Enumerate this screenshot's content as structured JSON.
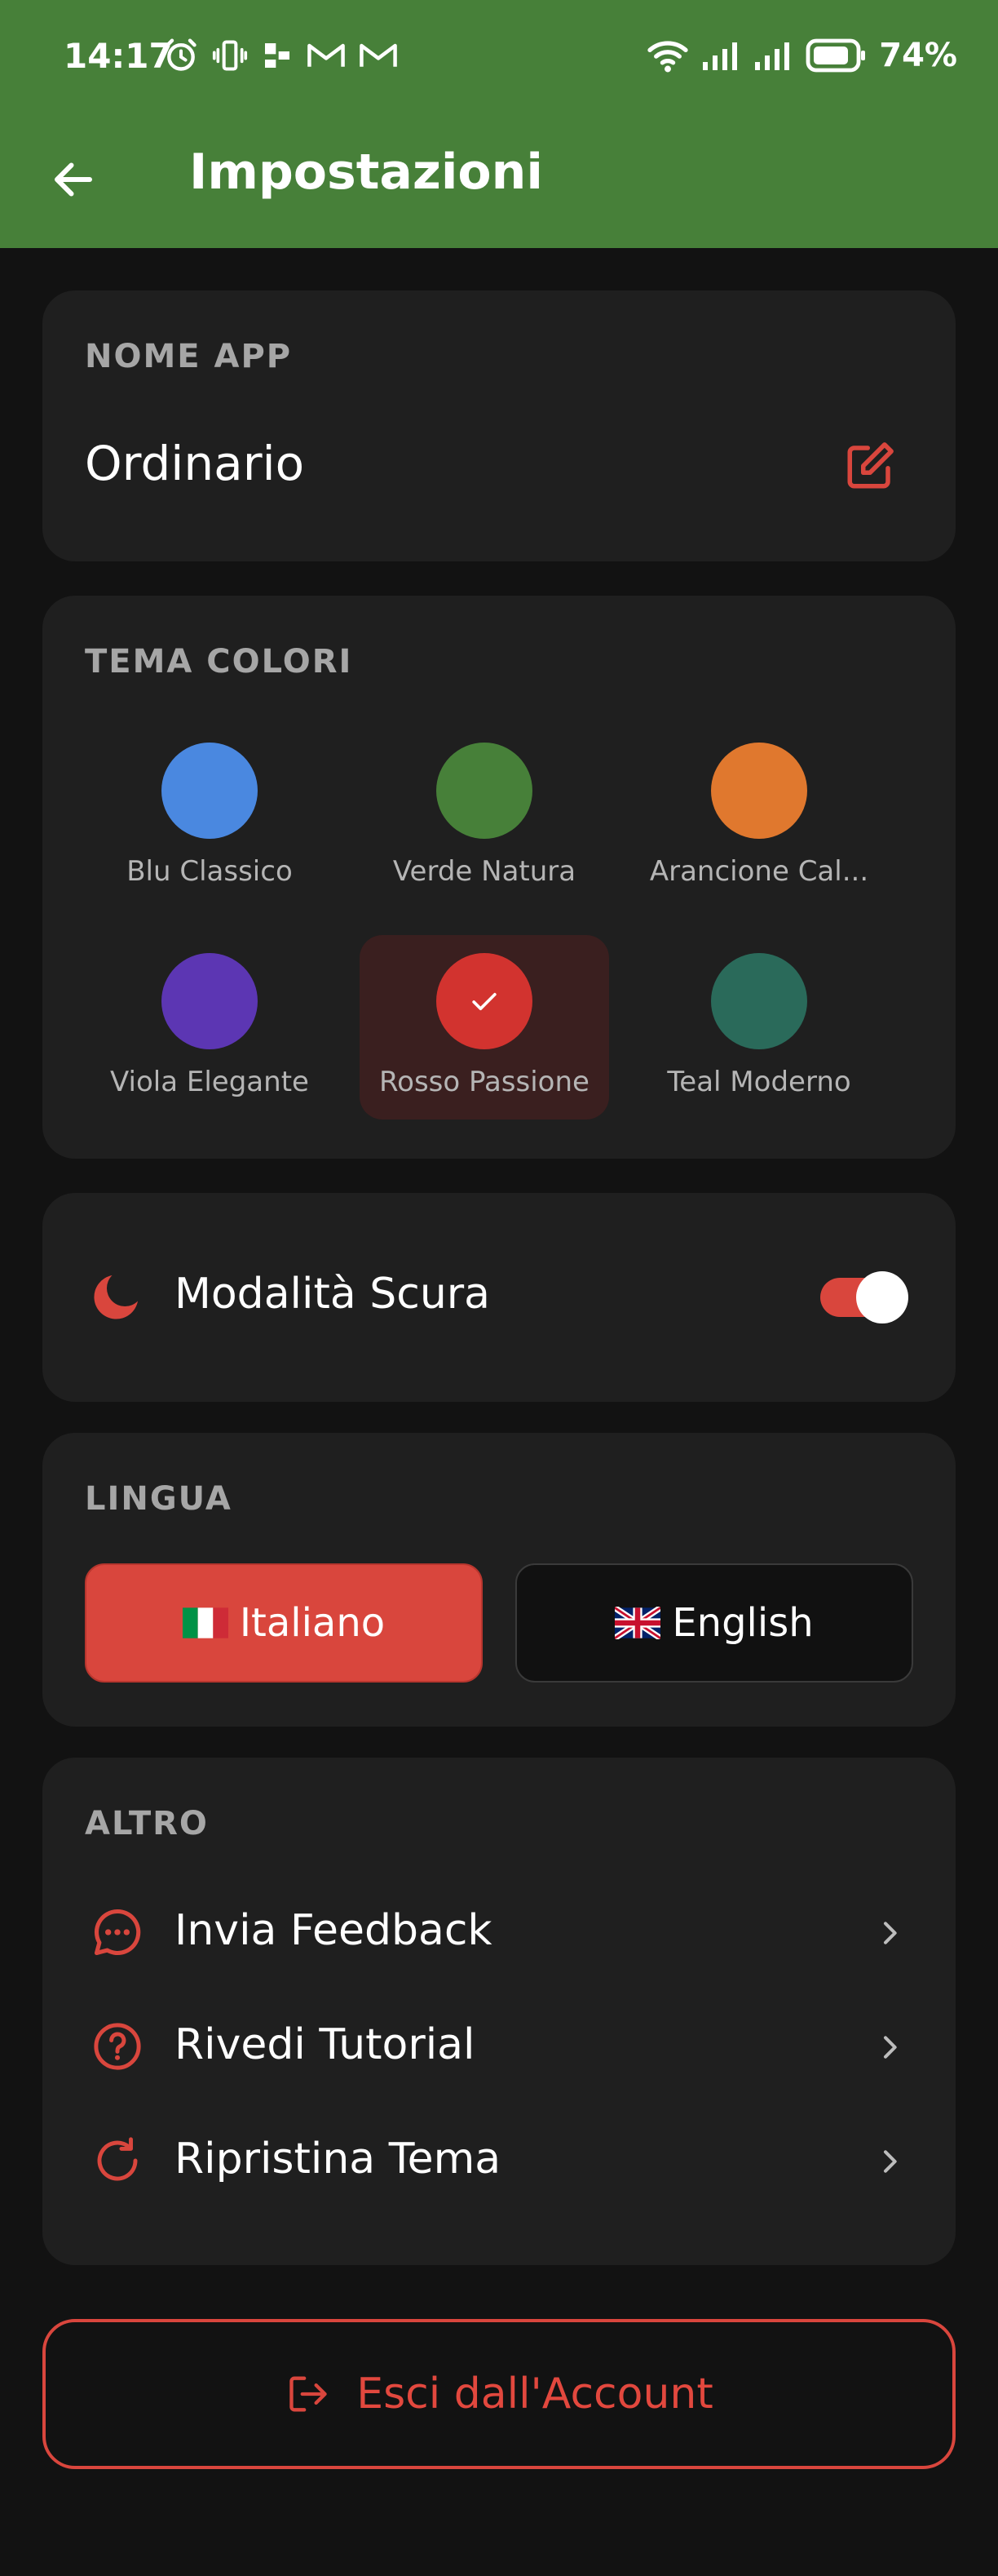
{
  "status_bar": {
    "time": "14:17",
    "battery_percent": "74%"
  },
  "header": {
    "title": "Impostazioni"
  },
  "app_name_section": {
    "label": "NOME APP",
    "value": "Ordinario"
  },
  "theme_section": {
    "label": "TEMA COLORI",
    "swatches": [
      {
        "label": "Blu Classico",
        "color": "#4a88e0"
      },
      {
        "label": "Verde Natura",
        "color": "#478039"
      },
      {
        "label": "Arancione Cal...",
        "color": "#e0782e"
      },
      {
        "label": "Viola Elegante",
        "color": "#5c36b3"
      },
      {
        "label": "Rosso Passione",
        "color": "#d2332f",
        "selected": true
      },
      {
        "label": "Teal Moderno",
        "color": "#2a6a5a"
      }
    ]
  },
  "dark_mode": {
    "label": "Modalità Scura",
    "enabled": true
  },
  "language_section": {
    "label": "LINGUA",
    "options": [
      {
        "label": "Italiano",
        "selected": true
      },
      {
        "label": "English",
        "selected": false
      }
    ]
  },
  "other_section": {
    "label": "ALTRO",
    "items": [
      {
        "label": "Invia Feedback",
        "icon": "chat-bubble-icon"
      },
      {
        "label": "Rivedi Tutorial",
        "icon": "help-circle-icon"
      },
      {
        "label": "Ripristina Tema",
        "icon": "refresh-icon"
      }
    ]
  },
  "logout": {
    "label": "Esci dall'Account"
  },
  "colors": {
    "header_green": "#478039",
    "accent_red": "#d9463d",
    "card_background": "#1f1f1f",
    "page_background": "#121212"
  }
}
